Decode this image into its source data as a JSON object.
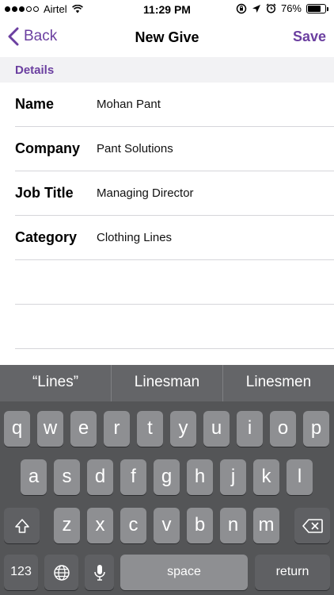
{
  "status_bar": {
    "carrier": "Airtel",
    "time": "11:29 PM",
    "battery": "76%",
    "battery_level": 0.76
  },
  "nav": {
    "back_label": "Back",
    "title": "New Give",
    "save_label": "Save"
  },
  "section": {
    "title": "Details"
  },
  "fields": [
    {
      "label": "Name",
      "value": "Mohan Pant"
    },
    {
      "label": "Company",
      "value": "Pant Solutions"
    },
    {
      "label": "Job Title",
      "value": "Managing Director"
    },
    {
      "label": "Category",
      "value": "Clothing Lines"
    }
  ],
  "keyboard": {
    "suggestions": [
      "“Lines”",
      "Linesman",
      "Linesmen"
    ],
    "row1": [
      "q",
      "w",
      "e",
      "r",
      "t",
      "y",
      "u",
      "i",
      "o",
      "p"
    ],
    "row2": [
      "a",
      "s",
      "d",
      "f",
      "g",
      "h",
      "j",
      "k",
      "l"
    ],
    "row3": [
      "z",
      "x",
      "c",
      "v",
      "b",
      "n",
      "m"
    ],
    "numbers_label": "123",
    "space_label": "space",
    "return_label": "return"
  },
  "colors": {
    "accent": "#6b3fa0",
    "keyboard_bg": "#545557",
    "key_bg": "#8e8f92"
  }
}
